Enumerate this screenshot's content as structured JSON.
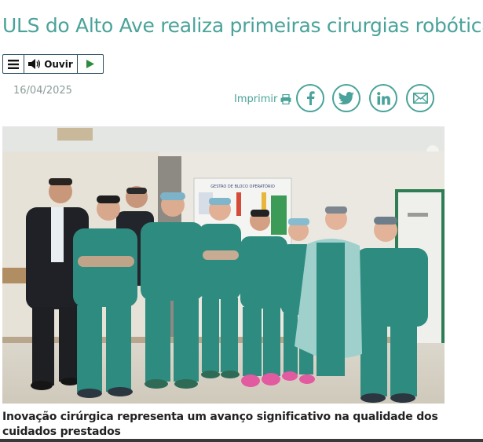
{
  "article": {
    "title": "ULS do Alto Ave realiza primeiras cirurgias robóticas",
    "date": "16/04/2025",
    "caption": "Inovação cirúrgica representa um avanço significativo na qualidade dos cuidados prestados"
  },
  "player": {
    "menu_icon": "hamburger-icon",
    "listen_label": "Ouvir",
    "speaker_icon": "speaker-icon",
    "play_icon": "play-icon"
  },
  "share": {
    "print_label": "Imprimir",
    "print_icon": "printer-icon",
    "buttons": [
      "facebook-icon",
      "twitter-icon",
      "linkedin-icon",
      "email-icon"
    ]
  },
  "colors": {
    "accent": "#4aa39a",
    "scrub_green": "#2e8b7f",
    "text_dark": "#222222",
    "date_gray": "#8a9a9a"
  },
  "photo": {
    "chart_board_heading": "GESTÃO DE BLOCO OPERATÓRIO"
  }
}
